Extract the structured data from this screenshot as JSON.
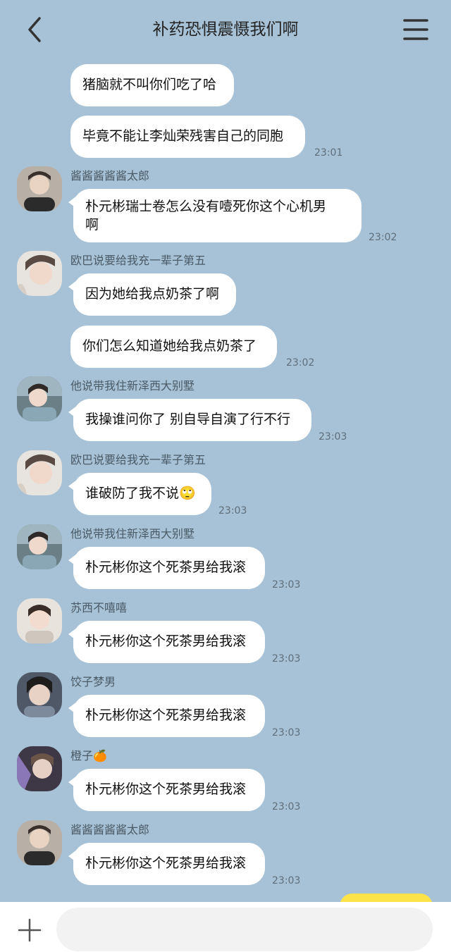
{
  "header": {
    "title": "补药恐惧震慑我们啊",
    "back_icon": "chevron-left-icon",
    "menu_icon": "hamburger-menu-icon"
  },
  "messages": [
    {
      "text": "猪脑就不叫你们吃了哈"
    },
    {
      "text": "毕竟不能让李灿荣残害自己的同胞",
      "time": "23:01"
    },
    {
      "sender": "酱酱酱酱酱太郎",
      "text": "朴元彬瑞士卷怎么没有噎死你这个心机男啊",
      "line1": "朴元彬瑞士卷怎么没有噎死你这个心机男",
      "line2": "啊",
      "time": "23:02"
    },
    {
      "sender": "欧巴说要给我充一辈子第五",
      "text": "因为她给我点奶茶了啊"
    },
    {
      "text": "你们怎么知道她给我点奶茶了",
      "time": "23:02"
    },
    {
      "sender": "他说带我住新泽西大别墅",
      "text": "我操谁问你了 别自导自演了行不行",
      "time": "23:03"
    },
    {
      "sender": "欧巴说要给我充一辈子第五",
      "text": "谁破防了我不说🙄",
      "time": "23:03"
    },
    {
      "sender": "他说带我住新泽西大别墅",
      "text": "朴元彬你这个死茶男给我滚",
      "time": "23:03"
    },
    {
      "sender": "苏西不嘻嘻",
      "text": "朴元彬你这个死茶男给我滚",
      "time": "23:03"
    },
    {
      "sender": "饺子梦男",
      "text": "朴元彬你这个死茶男给我滚",
      "time": "23:03"
    },
    {
      "sender": "橙子🍊",
      "text": "朴元彬你这个死茶男给我滚",
      "time": "23:03"
    },
    {
      "sender": "酱酱酱酱酱太郎",
      "text": "朴元彬你这个死茶男给我滚",
      "time": "23:03"
    }
  ],
  "input": {
    "placeholder": "",
    "plus_icon": "plus-icon"
  },
  "colors": {
    "background": "#a7c2d6",
    "bubble": "#ffffff",
    "accent_yellow": "#fde34a"
  }
}
